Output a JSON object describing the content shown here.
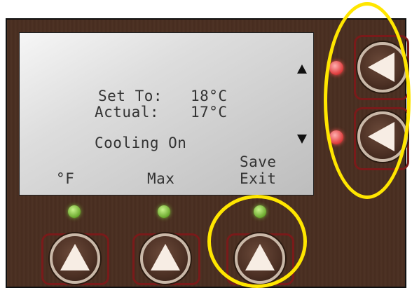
{
  "lcd": {
    "set_label": "Set To:",
    "set_value": "18°C",
    "actual_label": "Actual:",
    "actual_value": "17°C",
    "status": "Cooling On",
    "softkey_1": "°F",
    "softkey_2": "Max",
    "softkey_3_line1": "Save",
    "softkey_3_line2": "Exit"
  },
  "colors": {
    "panel": "#4a2e20",
    "button_frame": "#7a1a1a",
    "led_green": "#6aa82d",
    "led_red": "#e04040",
    "highlight": "#ffe600"
  }
}
